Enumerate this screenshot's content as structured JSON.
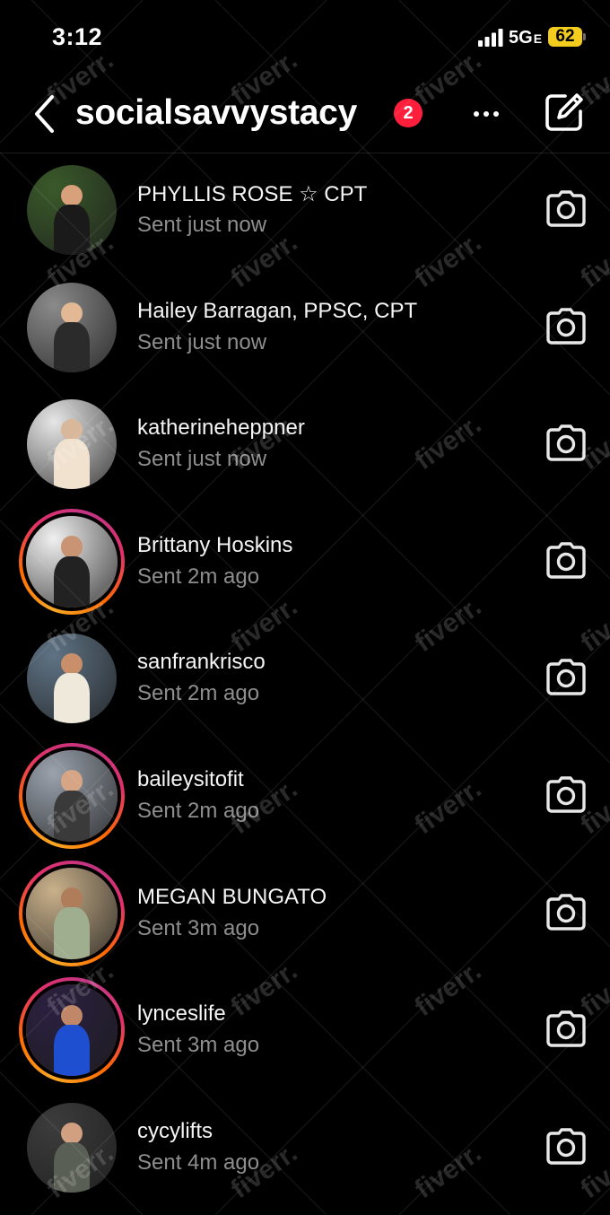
{
  "status": {
    "time": "3:12",
    "network": "5G",
    "network_suffix": "E",
    "battery": "62",
    "battery_color": "#f2cd1e"
  },
  "header": {
    "back_icon": "chevron-left-icon",
    "title": "socialsavvystacy",
    "badge": "2",
    "more_icon": "ellipsis-icon",
    "compose_icon": "compose-icon"
  },
  "conversations": [
    {
      "name": "PHYLLIS  ROSE ☆ CPT",
      "status": "Sent just now",
      "story_ring": false
    },
    {
      "name": "Hailey Barragan, PPSC, CPT",
      "status": "Sent just now",
      "story_ring": false
    },
    {
      "name": "katherineheppner",
      "status": "Sent just now",
      "story_ring": false
    },
    {
      "name": "Brittany Hoskins",
      "status": "Sent 2m ago",
      "story_ring": true
    },
    {
      "name": "sanfrankrisco",
      "status": "Sent 2m ago",
      "story_ring": false
    },
    {
      "name": "baileysitofit",
      "status": "Sent 2m ago",
      "story_ring": true
    },
    {
      "name": "MEGAN BUNGATO",
      "status": "Sent 3m ago",
      "story_ring": true
    },
    {
      "name": "lynceslife",
      "status": "Sent 3m ago",
      "story_ring": true
    },
    {
      "name": "cycylifts",
      "status": "Sent 4m ago",
      "story_ring": false
    }
  ],
  "watermark": "fiverr.",
  "colors": {
    "background": "#000000",
    "secondary_text": "#8e8e8e",
    "badge": "#ff1f3d"
  }
}
